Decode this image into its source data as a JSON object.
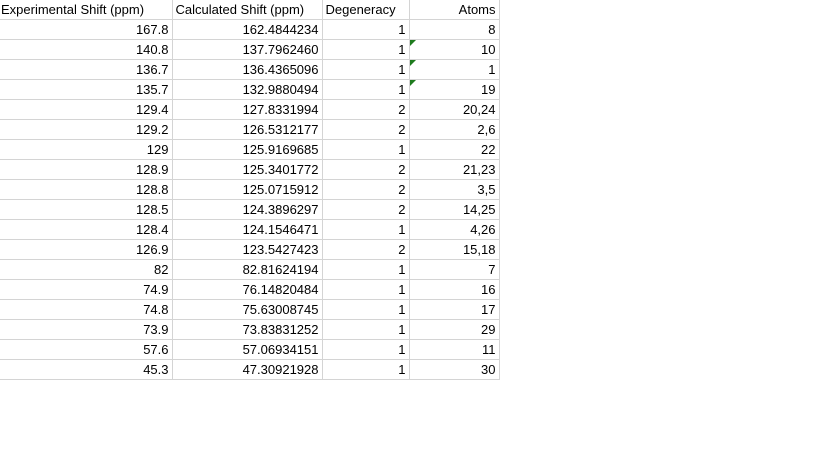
{
  "columns": [
    "Experimental Shift (ppm)",
    "Calculated Shift (ppm)",
    "Degeneracy",
    "Atoms"
  ],
  "rows": [
    {
      "exp": "167.8",
      "calc": "162.4844234",
      "deg": "1",
      "atoms": "8",
      "flag": false
    },
    {
      "exp": "140.8",
      "calc": "137.7962460",
      "deg": "1",
      "atoms": "10",
      "flag": true
    },
    {
      "exp": "136.7",
      "calc": "136.4365096",
      "deg": "1",
      "atoms": "1",
      "flag": true
    },
    {
      "exp": "135.7",
      "calc": "132.9880494",
      "deg": "1",
      "atoms": "19",
      "flag": true
    },
    {
      "exp": "129.4",
      "calc": "127.8331994",
      "deg": "2",
      "atoms": "20,24",
      "flag": false
    },
    {
      "exp": "129.2",
      "calc": "126.5312177",
      "deg": "2",
      "atoms": "2,6",
      "flag": false
    },
    {
      "exp": "129",
      "calc": "125.9169685",
      "deg": "1",
      "atoms": "22",
      "flag": false
    },
    {
      "exp": "128.9",
      "calc": "125.3401772",
      "deg": "2",
      "atoms": "21,23",
      "flag": false
    },
    {
      "exp": "128.8",
      "calc": "125.0715912",
      "deg": "2",
      "atoms": "3,5",
      "flag": false
    },
    {
      "exp": "128.5",
      "calc": "124.3896297",
      "deg": "2",
      "atoms": "14,25",
      "flag": false
    },
    {
      "exp": "128.4",
      "calc": "124.1546471",
      "deg": "1",
      "atoms": "4,26",
      "flag": false
    },
    {
      "exp": "126.9",
      "calc": "123.5427423",
      "deg": "2",
      "atoms": "15,18",
      "flag": false
    },
    {
      "exp": "82",
      "calc": "82.81624194",
      "deg": "1",
      "atoms": "7",
      "flag": false
    },
    {
      "exp": "74.9",
      "calc": "76.14820484",
      "deg": "1",
      "atoms": "16",
      "flag": false
    },
    {
      "exp": "74.8",
      "calc": "75.63008745",
      "deg": "1",
      "atoms": "17",
      "flag": false
    },
    {
      "exp": "73.9",
      "calc": "73.83831252",
      "deg": "1",
      "atoms": "29",
      "flag": false
    },
    {
      "exp": "57.6",
      "calc": "57.06934151",
      "deg": "1",
      "atoms": "11",
      "flag": false
    },
    {
      "exp": "45.3",
      "calc": "47.30921928",
      "deg": "1",
      "atoms": "30",
      "flag": false
    }
  ],
  "colors": {
    "gridline": "#d4d4d4",
    "error_flag": "#1e7b1e"
  }
}
